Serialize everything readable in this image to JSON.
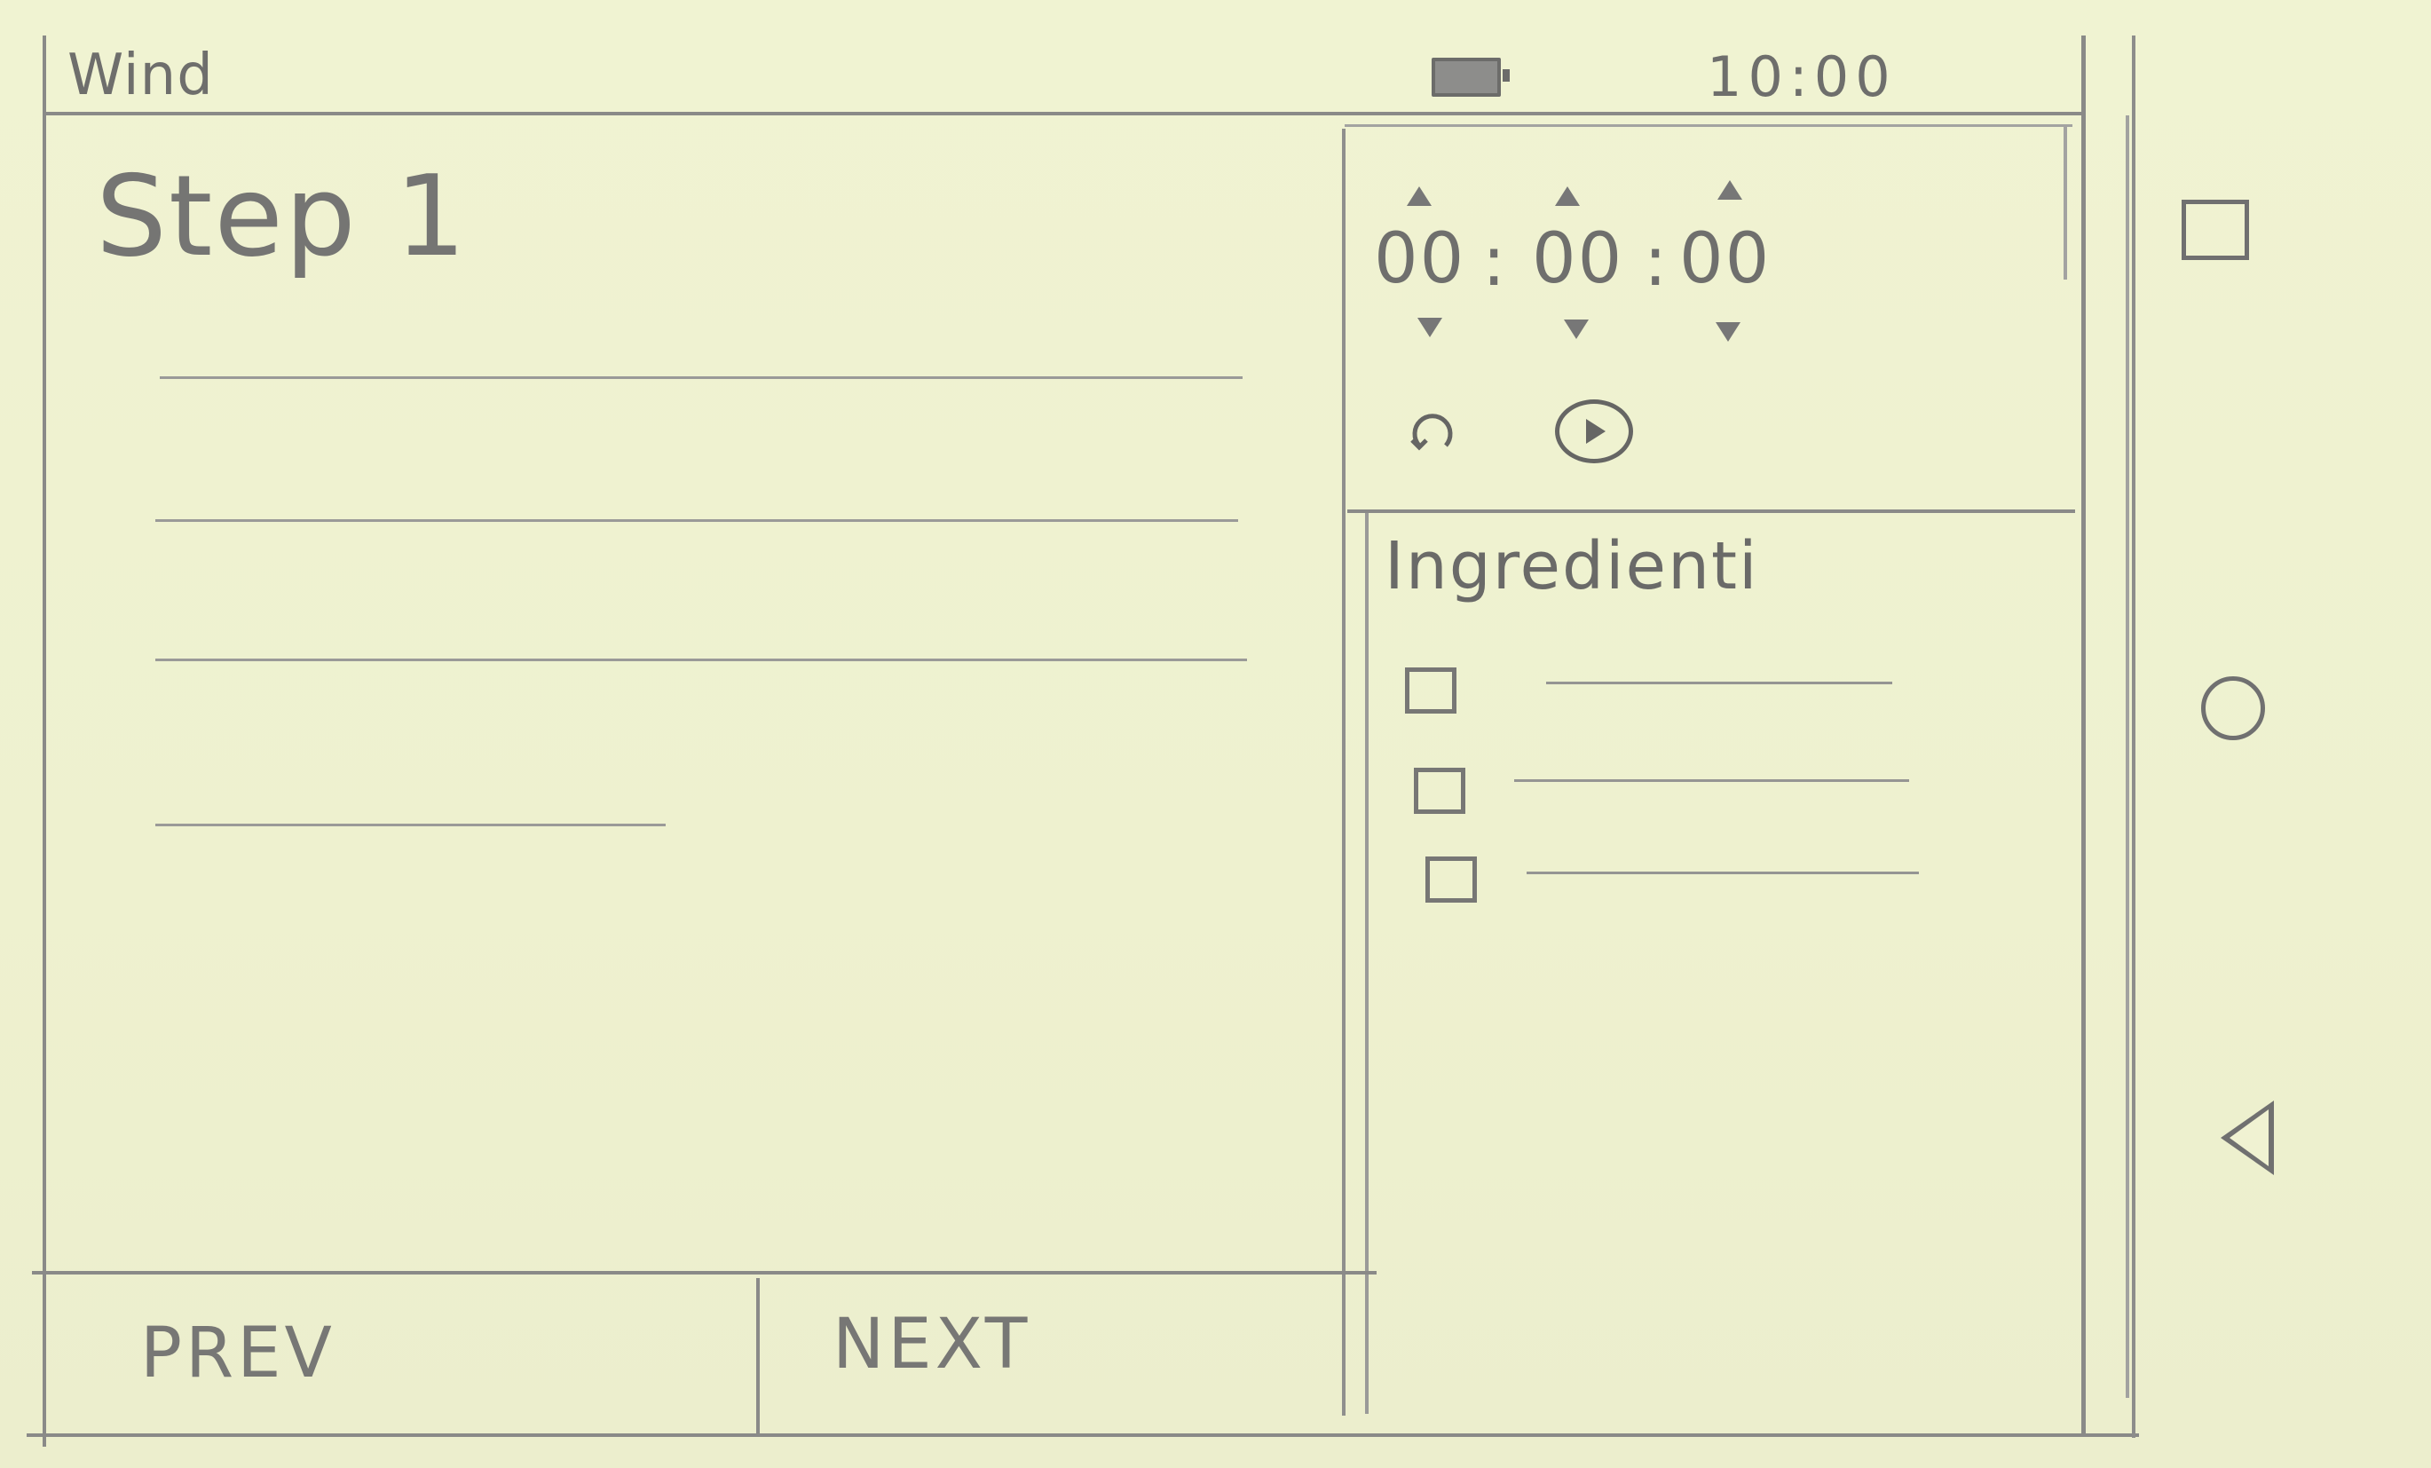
{
  "status_bar": {
    "app_name": "Wind",
    "time": "10:00",
    "battery_icon": "battery-icon"
  },
  "step": {
    "title": "Step 1"
  },
  "navigation": {
    "prev_label": "PREV",
    "next_label": "NEXT"
  },
  "timer": {
    "hours": "00",
    "minutes": "00",
    "seconds": "00",
    "separator": ":",
    "reset_icon": "reset-icon",
    "play_icon": "play-icon"
  },
  "ingredients": {
    "title": "Ingredienti",
    "item_count": 3
  },
  "system_nav": {
    "recents_icon": "square-icon",
    "home_icon": "circle-icon",
    "back_icon": "triangle-back-icon"
  },
  "colors": {
    "paper": "#eef1cf",
    "pencil": "#6f6f6d"
  }
}
